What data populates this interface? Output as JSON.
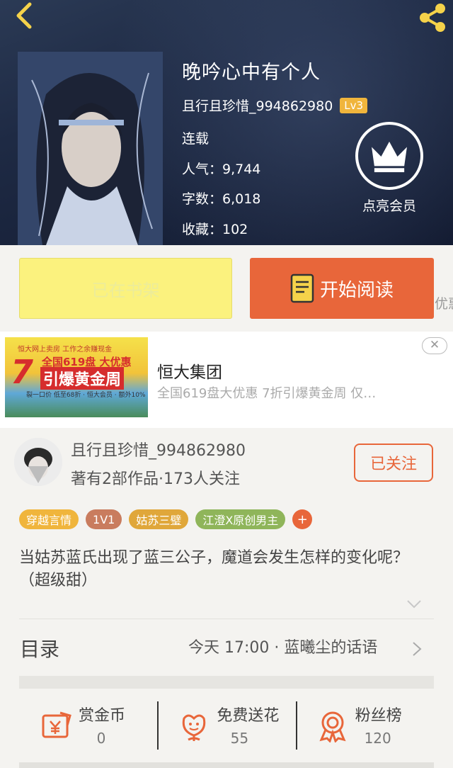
{
  "book": {
    "title": "晚吟心中有个人",
    "author": "且行且珍惜_994862980",
    "level": "Lv3",
    "status": "连载",
    "popularity": "人气：9,744",
    "word_count": "字数：6,018",
    "favorites": "收藏：102",
    "vip_label": "点亮会员"
  },
  "actions": {
    "shelf_label": "已在书架",
    "read_label": "开始阅读",
    "peek_text": "优惠"
  },
  "ad": {
    "title": "恒大集团",
    "desc": "全国619盘大优惠 7折引爆黄金周 仅…",
    "close": "✕",
    "img_line1": "恒大网上卖房  工作之余赚现金",
    "img_big": "7",
    "img_line2": "全国619盘 大优惠",
    "img_line3": "引爆黄金周",
    "img_line4": "裂一口价 低至68折 · 恒大会员 · 额外10%"
  },
  "author_section": {
    "name": "且行且珍惜_994862980",
    "info": "著有2部作品·173人关注",
    "follow_label": "已关注"
  },
  "tags": [
    {
      "label": "穿越言情",
      "color": "#f0b53c"
    },
    {
      "label": "1V1",
      "color": "#c97c5e"
    },
    {
      "label": "姑苏三璧",
      "color": "#e0a73a"
    },
    {
      "label": "江澄X原创男主",
      "color": "#8fb55a"
    }
  ],
  "tag_more": "+",
  "description": "当姑苏蓝氏出现了蓝三公子，魔道会发生怎样的变化呢？（超级甜）",
  "toc": {
    "label": "目录",
    "latest": "今天 17:00 · 蓝曦尘的话语"
  },
  "bottom": [
    {
      "label": "赏金币",
      "value": "0",
      "icon": "reward-coin-icon"
    },
    {
      "label": "免费送花",
      "value": "55",
      "icon": "flower-icon"
    },
    {
      "label": "粉丝榜",
      "value": "120",
      "icon": "fan-rank-icon"
    }
  ],
  "colors": {
    "accent": "#e8663a",
    "shelf_yellow": "#fbf27e"
  }
}
